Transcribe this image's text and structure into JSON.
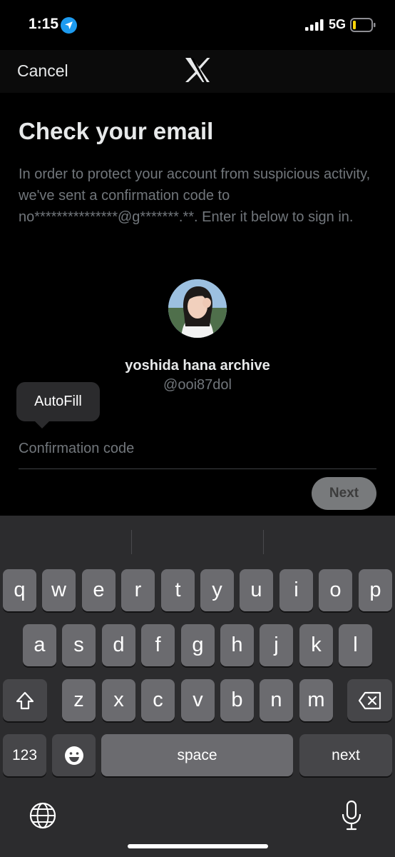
{
  "status_bar": {
    "time": "1:15",
    "network": "5G",
    "location_icon": "location-arrow-icon",
    "signal_icon": "cellular-signal-icon",
    "battery_icon": "battery-low-icon",
    "battery_color": "#ffd60a"
  },
  "nav": {
    "cancel_label": "Cancel",
    "logo_icon": "x-logo-icon"
  },
  "page": {
    "title": "Check your email",
    "description": "In order to protect your account from suspicious activity, we've sent a confirmation code to no***************@g*******.**. Enter it below to sign in."
  },
  "account": {
    "display_name": "yoshida hana archive",
    "handle": "@ooi87dol"
  },
  "autofill": {
    "label": "AutoFill"
  },
  "form": {
    "code_placeholder": "Confirmation code",
    "code_value": "",
    "next_label": "Next"
  },
  "keyboard": {
    "row1": [
      "q",
      "w",
      "e",
      "r",
      "t",
      "y",
      "u",
      "i",
      "o",
      "p"
    ],
    "row2": [
      "a",
      "s",
      "d",
      "f",
      "g",
      "h",
      "j",
      "k",
      "l"
    ],
    "row3": [
      "z",
      "x",
      "c",
      "v",
      "b",
      "n",
      "m"
    ],
    "numbers_label": "123",
    "space_label": "space",
    "return_label": "next",
    "shift_icon": "shift-icon",
    "delete_icon": "backspace-icon",
    "emoji_icon": "emoji-icon",
    "globe_icon": "globe-icon",
    "mic_icon": "microphone-icon"
  },
  "colors": {
    "accent": "#1d9bf0",
    "background": "#000000",
    "muted_text": "#71767b"
  }
}
